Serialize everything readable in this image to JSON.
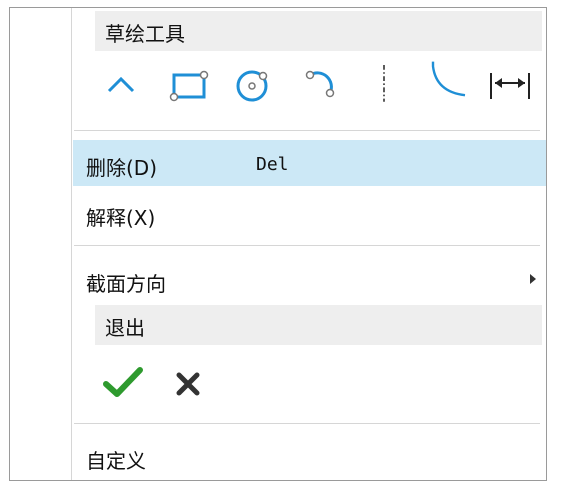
{
  "sketch_tools": {
    "title": "草绘工具",
    "tools": [
      {
        "name": "line-icon"
      },
      {
        "name": "rectangle-icon"
      },
      {
        "name": "circle-icon"
      },
      {
        "name": "arc-icon"
      },
      {
        "name": "centerline-icon"
      },
      {
        "name": "fillet-icon"
      },
      {
        "name": "dimension-icon"
      }
    ]
  },
  "menu_items": {
    "delete_label": "删除(D)",
    "delete_shortcut": "Del",
    "explain_label": "解释(X)",
    "section_orientation_label": "截面方向",
    "customize_label": "自定义"
  },
  "exit": {
    "title": "退出",
    "ok_icon": "checkmark-icon",
    "cancel_icon": "x-icon"
  },
  "colors": {
    "selection": "#cce8f6",
    "tool_blue": "#1f8fd6",
    "check_green": "#2e9a2e",
    "header_gray": "#eeeeee"
  }
}
